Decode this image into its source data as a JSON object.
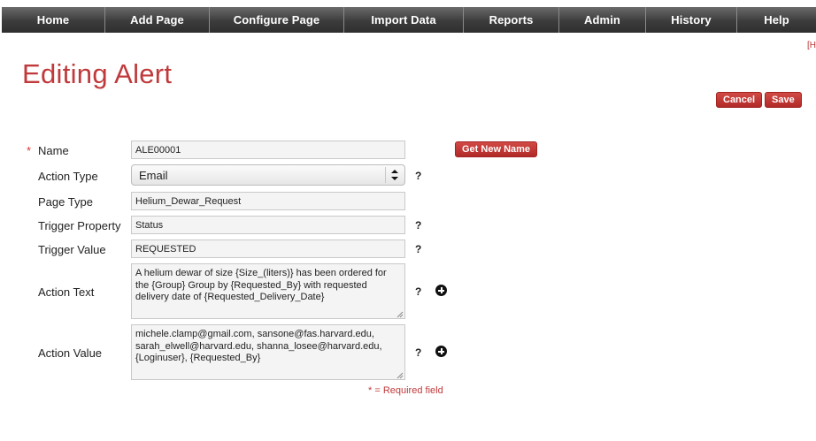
{
  "nav": {
    "items": [
      "Home",
      "Add Page",
      "Configure Page",
      "Import Data",
      "Reports",
      "Admin",
      "History",
      "Help"
    ]
  },
  "corner_link": "[H",
  "page_title": "Editing Alert",
  "actions": {
    "cancel": "Cancel",
    "save": "Save"
  },
  "form": {
    "required_star": "*",
    "name": {
      "label": "Name",
      "value": "ALE00001",
      "button": "Get New Name"
    },
    "action_type": {
      "label": "Action Type",
      "value": "Email",
      "help": "?"
    },
    "page_type": {
      "label": "Page Type",
      "value": "Helium_Dewar_Request"
    },
    "trigger_property": {
      "label": "Trigger Property",
      "value": "Status",
      "help": "?"
    },
    "trigger_value": {
      "label": "Trigger Value",
      "value": "REQUESTED",
      "help": "?"
    },
    "action_text": {
      "label": "Action Text",
      "value": "A helium dewar of size {Size_(liters)} has been ordered for the {Group} Group by {Requested_By} with requested delivery date of {Requested_Delivery_Date}",
      "help": "?"
    },
    "action_value": {
      "label": "Action Value",
      "value": "michele.clamp@gmail.com, sansone@fas.harvard.edu, sarah_elwell@harvard.edu, shanna_losee@harvard.edu, {Loginuser}, {Requested_By}",
      "help": "?"
    },
    "required_note": "* = Required field"
  },
  "colors": {
    "accent": "#c0393b",
    "nav_bg": "#3c3c3c"
  }
}
